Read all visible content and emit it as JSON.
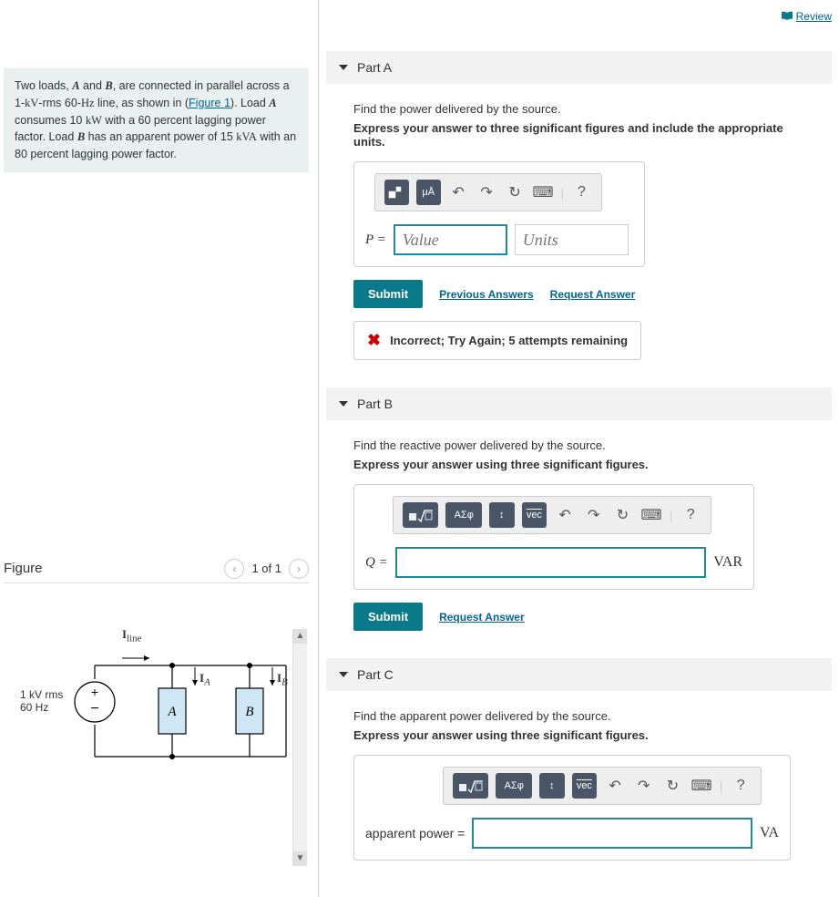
{
  "problem": {
    "text_pre": "Two loads, ",
    "varA": "A",
    "text_and": " and ",
    "varB": "B",
    "text_1": ", are connected in parallel across a 1-",
    "kV": "kV",
    "text_rms": "-rms 60-",
    "Hz": "Hz",
    "text_line": " line, as shown in (",
    "figlink": "Figure 1",
    "text_close": "). Load ",
    "varA2": "A",
    "text_loadA": " consumes 10 ",
    "kW": "kW",
    "text_loadA2": " with a 60 percent lagging power factor. Load ",
    "varB2": "B",
    "text_loadB": " has an apparent power of 15 ",
    "kVA": "kVA",
    "text_loadB2": " with an 80 percent lagging power factor."
  },
  "figure": {
    "title": "Figure",
    "page": "1 of 1",
    "labels": {
      "Iline": "I",
      "Iline_sub": "line",
      "IA": "I",
      "IA_sub": "A",
      "IB": "I",
      "IB_sub": "B",
      "A": "A",
      "B": "B",
      "src1": "1 kV rms",
      "src2": "60 Hz"
    }
  },
  "review": "Review",
  "partA": {
    "title": "Part A",
    "instr": "Find the power delivered by the source.",
    "bold": "Express your answer to three significant figures and include the appropriate units.",
    "eqlabel": "P =",
    "val_ph": "Value",
    "unit_ph": "Units",
    "tool_mu": "μÅ",
    "submit": "Submit",
    "prev": "Previous Answers",
    "req": "Request Answer",
    "feedback": "Incorrect; Try Again; 5 attempts remaining"
  },
  "partB": {
    "title": "Part B",
    "instr": "Find the reactive power delivered by the source.",
    "bold": "Express your answer using three significant figures.",
    "eqlabel": "Q =",
    "unit": "VAR",
    "tool_asphi": "ΑΣφ",
    "tool_vec": "vec",
    "submit": "Submit",
    "req": "Request Answer"
  },
  "partC": {
    "title": "Part C",
    "instr": "Find the apparent power delivered by the source.",
    "bold": "Express your answer using three significant figures.",
    "eqlabel": "apparent power =",
    "unit": "VA",
    "tool_asphi": "ΑΣφ",
    "tool_vec": "vec"
  },
  "icons": {
    "undo": "↶",
    "redo": "↷",
    "reset": "↻",
    "kbd": "⌨",
    "help": "?",
    "updown": "↕"
  }
}
